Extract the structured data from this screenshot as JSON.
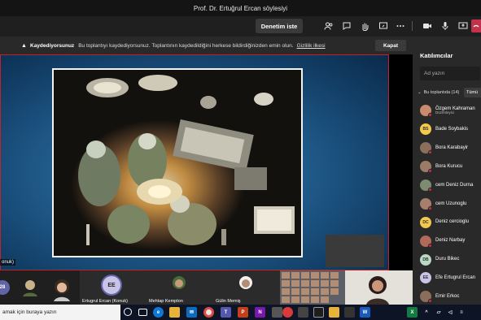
{
  "window": {
    "title": "Prof. Dr. Ertuğrul Ercan söylesiyi"
  },
  "toolbar": {
    "request_label": "Denetim iste",
    "icons": [
      "participants-icon",
      "chat-icon",
      "raise-hand-icon",
      "share-tray-icon",
      "more-icon",
      "camera-icon",
      "mic-icon",
      "share-screen-icon",
      "leave-icon"
    ]
  },
  "banner": {
    "title": "Kaydediyorsunuz",
    "message": "Bu toplantıyı kaydediyorsunuz. Toplantının kaydedildiğini herkese bildirdiğinizden emin olun.",
    "link": "Gizlilik ilkesi",
    "close_label": "Kapat"
  },
  "stage": {
    "guest_tag": "onuk)"
  },
  "participants": {
    "title": "Katılımcılar",
    "search_placeholder": "Ad yazın",
    "section_label": "Bu toplantıda (14)",
    "all_label": "Tümü",
    "people": [
      {
        "name": "Özgem Kahraman",
        "role": "Düzenleyici",
        "initials": "",
        "color": "#c98b6b",
        "photo": true
      },
      {
        "name": "Bade Soybakis",
        "role": "",
        "initials": "BS",
        "color": "#f2c94c",
        "photo": false
      },
      {
        "name": "Bora Karabayir",
        "role": "",
        "initials": "",
        "color": "#8a6f5a",
        "photo": true
      },
      {
        "name": "Bora Kurucu",
        "role": "",
        "initials": "",
        "color": "#9b7b66",
        "photo": true
      },
      {
        "name": "cem Deniz Durna",
        "role": "",
        "initials": "",
        "color": "#7c8c70",
        "photo": true
      },
      {
        "name": "cem Uzunoglu",
        "role": "",
        "initials": "",
        "color": "#a87f6c",
        "photo": true
      },
      {
        "name": "Deniz cercioglu",
        "role": "",
        "initials": "DC",
        "color": "#f2c94c",
        "photo": false
      },
      {
        "name": "Deniz Narbay",
        "role": "",
        "initials": "",
        "color": "#b06a5a",
        "photo": true
      },
      {
        "name": "Duru Bikec",
        "role": "",
        "initials": "DB",
        "color": "#b9d9c2",
        "photo": false
      },
      {
        "name": "Efe Ertugrul Ercan",
        "role": "",
        "initials": "EE",
        "color": "#c9c3e8",
        "photo": false
      },
      {
        "name": "Emir Erkoc",
        "role": "",
        "initials": "",
        "color": "#8b6d5c",
        "photo": true
      }
    ]
  },
  "gallery": {
    "count_badge": "28",
    "ee_initials": "EE",
    "ee_label": "Ertugrul Ercan (Konuk)",
    "tile3_label": "Mehtap Kempton",
    "tile4_label": "Gülin Memiş"
  },
  "taskbar": {
    "search_text": "amak için buraya yazın",
    "apps": [
      "cortana-icon",
      "task-view-icon",
      "edge-icon",
      "explorer-icon",
      "mail-icon",
      "chrome-icon",
      "teams-icon",
      "powerpoint-icon",
      "onenote-icon",
      "store-icon",
      "app-icon",
      "screen-recorder-icon",
      "camera-app-icon",
      "explorer2-icon",
      "media-icon",
      "word-icon",
      "excel-icon"
    ]
  }
}
